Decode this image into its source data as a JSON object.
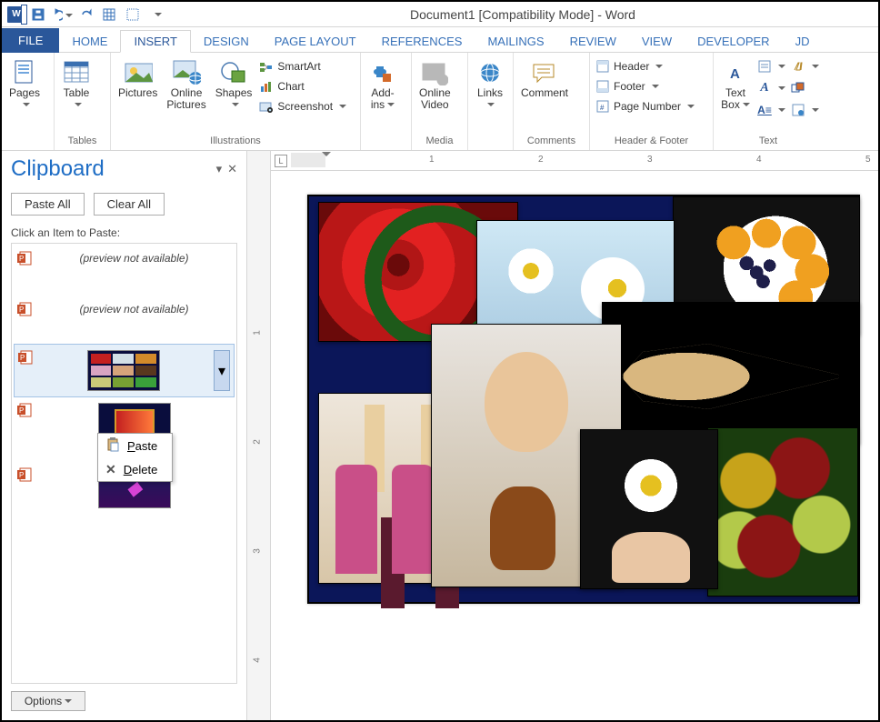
{
  "title": "Document1 [Compatibility Mode] - Word",
  "tabs": {
    "file": "FILE",
    "home": "HOME",
    "insert": "INSERT",
    "design": "DESIGN",
    "layout": "PAGE LAYOUT",
    "references": "REFERENCES",
    "mailings": "MAILINGS",
    "review": "REVIEW",
    "view": "VIEW",
    "developer": "DEVELOPER",
    "extra": "JD"
  },
  "ribbon": {
    "pages": "Pages",
    "tables": {
      "table": "Table",
      "group": "Tables"
    },
    "illus": {
      "pictures": "Pictures",
      "online": "Online\nPictures",
      "shapes": "Shapes",
      "smartart": "SmartArt",
      "chart": "Chart",
      "screenshot": "Screenshot",
      "group": "Illustrations"
    },
    "addins": {
      "label": "Add-\nins"
    },
    "media": {
      "label": "Online\nVideo",
      "group": "Media"
    },
    "links": {
      "label": "Links"
    },
    "comments": {
      "label": "Comment",
      "group": "Comments"
    },
    "hf": {
      "header": "Header",
      "footer": "Footer",
      "pagenum": "Page Number",
      "group": "Header & Footer"
    },
    "text": {
      "textbox": "Text\nBox",
      "group": "Text"
    }
  },
  "clipboard": {
    "title": "Clipboard",
    "paste_all": "Paste All",
    "clear_all": "Clear All",
    "hint": "Click an Item to Paste:",
    "na": "(preview not available)",
    "ctx_paste": "Paste",
    "ctx_delete": "Delete",
    "options": "Options"
  },
  "ruler": {
    "h": [
      "1",
      "2",
      "3",
      "4",
      "5"
    ],
    "v": [
      "1",
      "2",
      "3",
      "4"
    ]
  }
}
